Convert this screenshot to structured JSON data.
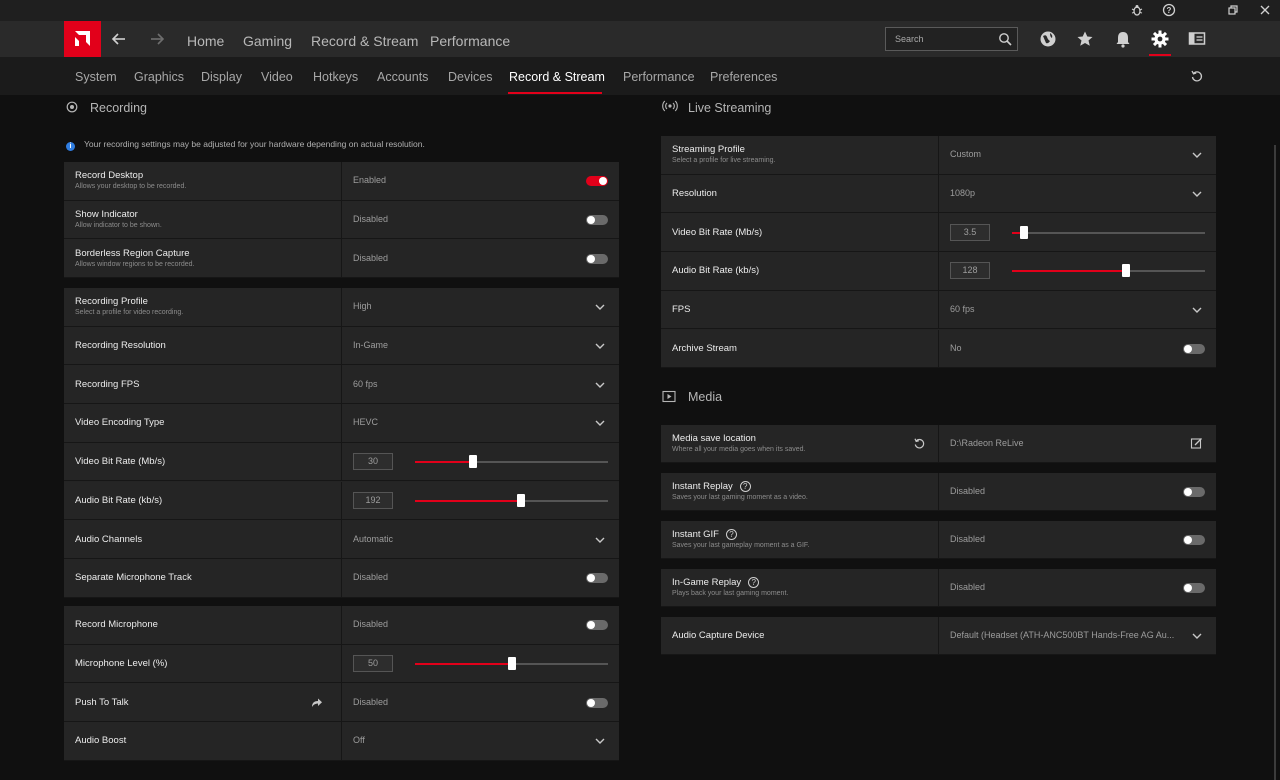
{
  "main_nav": {
    "items": [
      "Home",
      "Gaming",
      "Record & Stream",
      "Performance"
    ],
    "search_placeholder": "Search"
  },
  "icons": {
    "window": [
      "bug-icon",
      "help-icon",
      "restore-icon",
      "close-icon"
    ],
    "top": [
      "globe-icon",
      "star-icon",
      "bell-icon",
      "gear-icon",
      "sidebar-panel-icon"
    ]
  },
  "sub_nav": {
    "items": [
      "System",
      "Graphics",
      "Display",
      "Video",
      "Hotkeys",
      "Accounts",
      "Devices",
      "Record & Stream",
      "Performance",
      "Preferences"
    ],
    "active": "Record & Stream"
  },
  "recording": {
    "title": "Recording",
    "notice": "Your recording settings may be adjusted for your hardware depending on actual resolution.",
    "group1": [
      {
        "label": "Record Desktop",
        "sub": "Allows your desktop to be recorded.",
        "value": "Enabled",
        "control": "toggle",
        "on": true
      },
      {
        "label": "Show Indicator",
        "sub": "Allow indicator to be shown.",
        "value": "Disabled",
        "control": "toggle",
        "on": false
      },
      {
        "label": "Borderless Region Capture",
        "sub": "Allows window regions to be recorded.",
        "value": "Disabled",
        "control": "toggle",
        "on": false
      }
    ],
    "group2": [
      {
        "label": "Recording Profile",
        "sub": "Select a profile for video recording.",
        "value": "High",
        "control": "dropdown"
      },
      {
        "label": "Recording Resolution",
        "sub": "",
        "value": "In-Game",
        "control": "dropdown"
      },
      {
        "label": "Recording FPS",
        "sub": "",
        "value": "60 fps",
        "control": "dropdown"
      },
      {
        "label": "Video Encoding Type",
        "sub": "",
        "value": "HEVC",
        "control": "dropdown"
      },
      {
        "label": "Video Bit Rate (Mb/s)",
        "sub": "",
        "value": "30",
        "control": "slider",
        "fraction": 0.3
      },
      {
        "label": "Audio Bit Rate (kb/s)",
        "sub": "",
        "value": "192",
        "control": "slider",
        "fraction": 0.55
      },
      {
        "label": "Audio Channels",
        "sub": "",
        "value": "Automatic",
        "control": "dropdown"
      },
      {
        "label": "Separate Microphone Track",
        "sub": "",
        "value": "Disabled",
        "control": "toggle",
        "on": false
      }
    ],
    "group3": [
      {
        "label": "Record Microphone",
        "sub": "",
        "value": "Disabled",
        "control": "toggle",
        "on": false
      },
      {
        "label": "Microphone Level (%)",
        "sub": "",
        "value": "50",
        "control": "slider",
        "fraction": 0.5
      },
      {
        "label": "Push To Talk",
        "sub": "",
        "value": "Disabled",
        "control": "toggle",
        "on": false,
        "extra_icon": "share-arrow-icon"
      },
      {
        "label": "Audio Boost",
        "sub": "",
        "value": "Off",
        "control": "dropdown"
      }
    ]
  },
  "live_streaming": {
    "title": "Live Streaming",
    "rows": [
      {
        "label": "Streaming Profile",
        "sub": "Select a profile for live streaming.",
        "value": "Custom",
        "control": "dropdown"
      },
      {
        "label": "Resolution",
        "sub": "",
        "value": "1080p",
        "control": "dropdown"
      },
      {
        "label": "Video Bit Rate (Mb/s)",
        "sub": "",
        "value": "3.5",
        "control": "slider",
        "fraction": 0.06
      },
      {
        "label": "Audio Bit Rate (kb/s)",
        "sub": "",
        "value": "128",
        "control": "slider",
        "fraction": 0.59
      },
      {
        "label": "FPS",
        "sub": "",
        "value": "60 fps",
        "control": "dropdown"
      },
      {
        "label": "Archive Stream",
        "sub": "",
        "value": "No",
        "control": "toggle",
        "on": false
      }
    ]
  },
  "media": {
    "title": "Media",
    "location": {
      "label": "Media save location",
      "sub": "Where all your media goes when its saved.",
      "value": "D:\\Radeon ReLive"
    },
    "cards": [
      {
        "label": "Instant Replay",
        "sub": "Saves your last gaming moment as a video.",
        "value": "Disabled",
        "control": "toggle",
        "on": false,
        "help": "?"
      },
      {
        "label": "Instant GIF",
        "sub": "Saves your last gameplay moment as a GIF.",
        "value": "Disabled",
        "control": "toggle",
        "on": false,
        "help": "?"
      },
      {
        "label": "In-Game Replay",
        "sub": "Plays back your last gaming moment.",
        "value": "Disabled",
        "control": "toggle",
        "on": false,
        "help": "?"
      },
      {
        "label": "Audio Capture Device",
        "sub": "",
        "value": "Default (Headset (ATH-ANC500BT Hands-Free AG Au...",
        "control": "dropdown"
      }
    ]
  },
  "colors": {
    "accent": "#e2001a",
    "background": "#101010",
    "row": "#252525"
  }
}
